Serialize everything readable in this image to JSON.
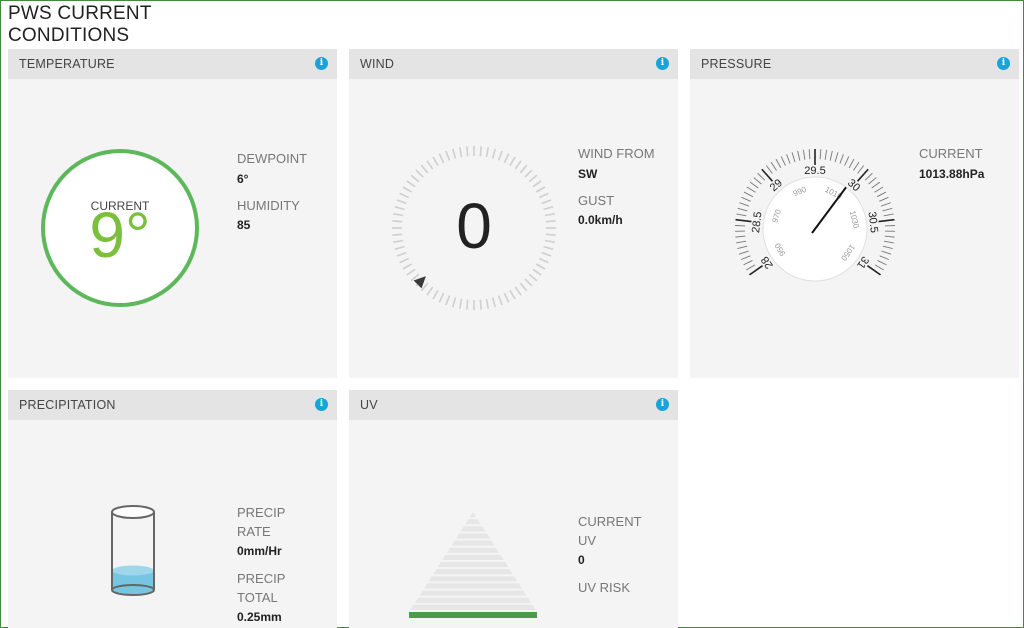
{
  "page": {
    "title": "PWS CURRENT CONDITIONS"
  },
  "colors": {
    "accent_green": "#5db85c",
    "info_blue": "#1aa3d8",
    "water": "#76c6e2",
    "uv_band": "#4c9a4c"
  },
  "icons": {
    "info": "info-icon",
    "gauge_pointer": "triangle-pointer-icon"
  },
  "temperature": {
    "title": "TEMPERATURE",
    "current_label": "CURRENT",
    "current_value": "9°",
    "dewpoint_label": "DEWPOINT",
    "dewpoint_value": "6°",
    "humidity_label": "HUMIDITY",
    "humidity_value": "85"
  },
  "wind": {
    "title": "WIND",
    "speed": "0",
    "direction_degrees": 225,
    "from_label": "WIND FROM",
    "from_value": "SW",
    "gust_label": "GUST",
    "gust_value": "0.0km/h"
  },
  "pressure": {
    "title": "PRESSURE",
    "current_label": "CURRENT",
    "current_value": "1013.88hPa",
    "needle_inhg": 29.94,
    "inhg_ticks": [
      "28",
      "28.5",
      "29",
      "29.5",
      "30",
      "30.5",
      "31"
    ],
    "hpa_ticks": [
      "950",
      "970",
      "990",
      "1010",
      "1030",
      "1050"
    ]
  },
  "precipitation": {
    "title": "PRECIPITATION",
    "rate_label_1": "PRECIP",
    "rate_label_2": "RATE",
    "rate_value": "0mm/Hr",
    "total_label_1": "PRECIP",
    "total_label_2": "TOTAL",
    "total_value": "0.25mm",
    "fill_fraction": 0.25
  },
  "uv": {
    "title": "UV",
    "current_label_1": "CURRENT",
    "current_label_2": "UV",
    "current_value": "0",
    "risk_label": "UV RISK",
    "risk_value": ""
  }
}
